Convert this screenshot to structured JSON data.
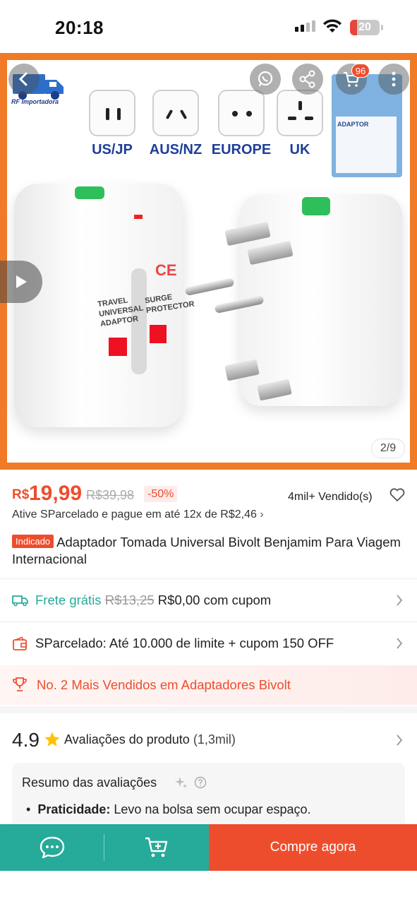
{
  "status_bar": {
    "time": "20:18",
    "battery": "20",
    "icons": [
      "cellular-signal-icon",
      "wifi-icon",
      "battery-icon"
    ]
  },
  "gallery": {
    "brand_logo_text": "RF Importadora",
    "plug_types": [
      "US/JP",
      "AUS/NZ",
      "EUROPE",
      "UK"
    ],
    "package_label": "ADAPTOR",
    "adapter_text_left": "TRAVEL UNIVERSAL ADAPTOR",
    "adapter_text_right": "SURGE PROTECTOR",
    "adapter_ce": "CE",
    "pager": "2/9",
    "cart_count": "96",
    "icons": [
      "back-arrow-icon",
      "whatsapp-icon",
      "share-icon",
      "cart-icon",
      "more-icon",
      "play-icon"
    ]
  },
  "price": {
    "currency": "R$",
    "current": "19,99",
    "original": "R$39,98",
    "discount": "-50%",
    "sold": "4mil+ Vendido(s)",
    "installment": "Ative SParcelado e pague em até 12x de R$2,46",
    "installment_arrow": "›"
  },
  "product": {
    "tag": "Indicado",
    "title": "Adaptador Tomada Universal Bivolt Benjamim Para Viagem Internacional"
  },
  "shipping": {
    "label": "Frete grátis",
    "old": "R$13,25",
    "new": "R$0,00 com cupom"
  },
  "sparcelado": {
    "text": "SParcelado: Até 10.000 de limite + cupom 150 OFF"
  },
  "ranking": {
    "text": "No. 2 Mais Vendidos em Adaptadores Bivolt"
  },
  "rating": {
    "score": "4.9",
    "label": "Avaliações do produto",
    "count": "(1,3mil)"
  },
  "review_summary": {
    "heading": "Resumo das avaliações",
    "bullet_key": "Praticidade:",
    "bullet_text": " Levo na bolsa sem ocupar espaço."
  },
  "bottom_bar": {
    "buy_label": "Compre agora"
  },
  "colors": {
    "shopee_orange": "#ee4d2d",
    "teal": "#26aa99",
    "frame_orange": "#f07a26"
  }
}
